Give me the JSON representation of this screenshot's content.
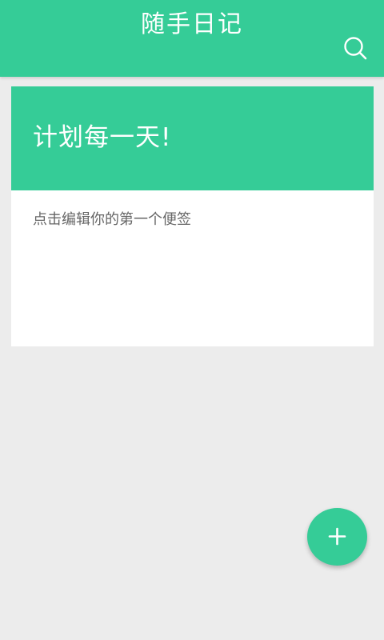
{
  "app_bar": {
    "title": "随手日记",
    "search_icon": "search-icon"
  },
  "note": {
    "title": "计划每一天!",
    "body": "点击编辑你的第一个便签"
  },
  "fab": {
    "icon": "plus-icon"
  },
  "colors": {
    "primary": "#35cc97",
    "background": "#ececec",
    "card": "#ffffff",
    "body_text": "#666666"
  }
}
